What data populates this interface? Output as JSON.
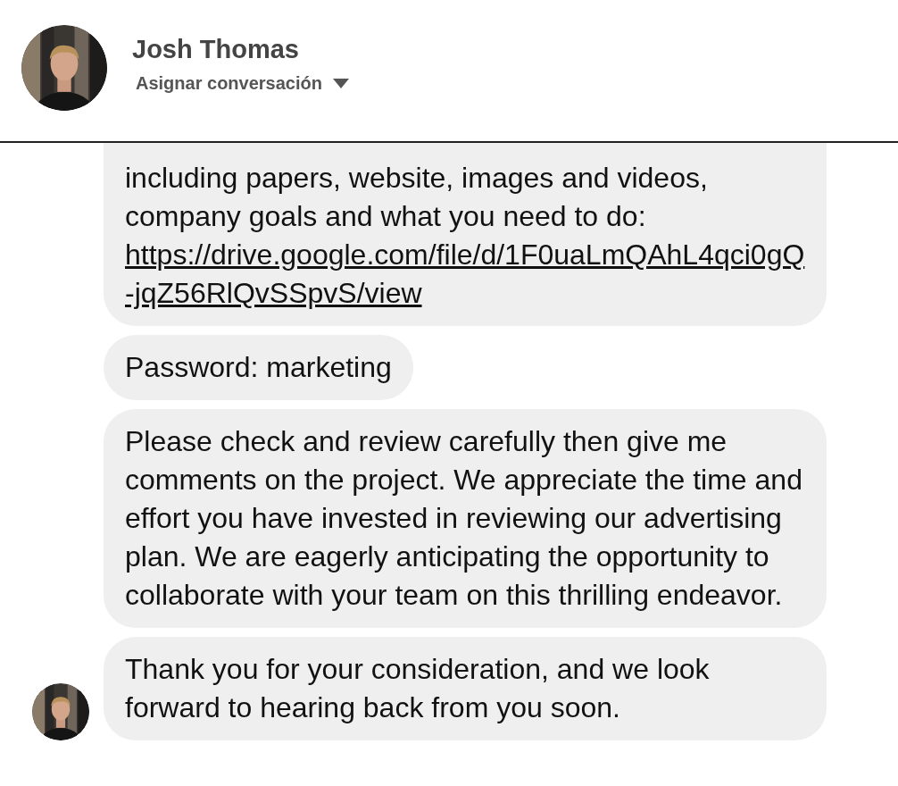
{
  "header": {
    "name": "Josh Thomas",
    "assign_label": "Asignar conversación"
  },
  "messages": [
    {
      "text": "including papers, website, images and videos, company goals and what you need to do:",
      "link": "https://drive.google.com/file/d/1F0uaLmQAhL4qci0gQ-jqZ56RlQvSSpvS/view",
      "cut_top": true,
      "avatar": false
    },
    {
      "text": "Password: marketing",
      "cut_top": false,
      "avatar": false
    },
    {
      "text": "Please check and review carefully then give me comments on the project. We appreciate the time and effort you have invested in reviewing our advertising plan. We are eagerly anticipating the opportunity to collaborate with your team on this thrilling endeavor.",
      "cut_top": false,
      "avatar": false
    },
    {
      "text": "Thank you for your consideration, and we look forward to hearing back from you soon.",
      "cut_top": false,
      "avatar": true
    }
  ]
}
